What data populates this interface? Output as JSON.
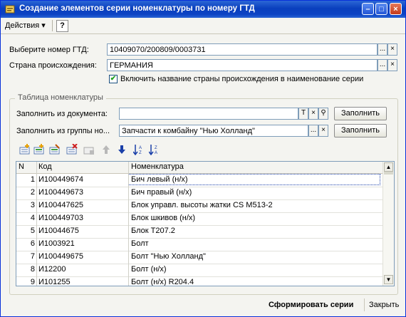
{
  "window": {
    "title": "Создание элементов серии номенклатуры по номеру ГТД"
  },
  "menu": {
    "actions": "Действия",
    "help": "?"
  },
  "form": {
    "gtd_label": "Выберите номер ГТД:",
    "gtd_value": "10409070/200809/0003731",
    "country_label": "Страна происхождения:",
    "country_value": "ГЕРМАНИЯ",
    "include_country_label": "Включить название страны происхождения в наименование серии",
    "include_country_checked": "✔",
    "ellipsis": "...",
    "clear": "×"
  },
  "group": {
    "title": "Таблица номенклатуры",
    "fill_doc_label": "Заполнить из документа:",
    "fill_doc_value": "",
    "fill_group_label": "Заполнить из группы но...",
    "fill_group_value": "Запчасти  к  комбайну \"Нью Холланд\"",
    "fill_button": "Заполнить",
    "t_btn": "T"
  },
  "table": {
    "headers": {
      "n": "N",
      "code": "Код",
      "item": "Номенклатура"
    },
    "rows": [
      {
        "n": "1",
        "code": "И100449674",
        "item": "Бич левый (н/х)"
      },
      {
        "n": "2",
        "code": "И100449673",
        "item": "Бич правый (н/х)"
      },
      {
        "n": "3",
        "code": "И100447625",
        "item": "Блок управл. высоты жатки CS M513-2"
      },
      {
        "n": "4",
        "code": "И100449703",
        "item": "Блок шкивов (н/х)"
      },
      {
        "n": "5",
        "code": "И10044675",
        "item": "Блок T207.2"
      },
      {
        "n": "6",
        "code": "И1003921",
        "item": "Болт"
      },
      {
        "n": "7",
        "code": "И100449675",
        "item": "Болт \"Нью Холланд\""
      },
      {
        "n": "8",
        "code": "И12200",
        "item": "Болт (н/х)"
      },
      {
        "n": "9",
        "code": "И101255",
        "item": "Болт (н/х) R204.4"
      }
    ]
  },
  "footer": {
    "create": "Сформировать серии",
    "close": "Закрыть"
  }
}
